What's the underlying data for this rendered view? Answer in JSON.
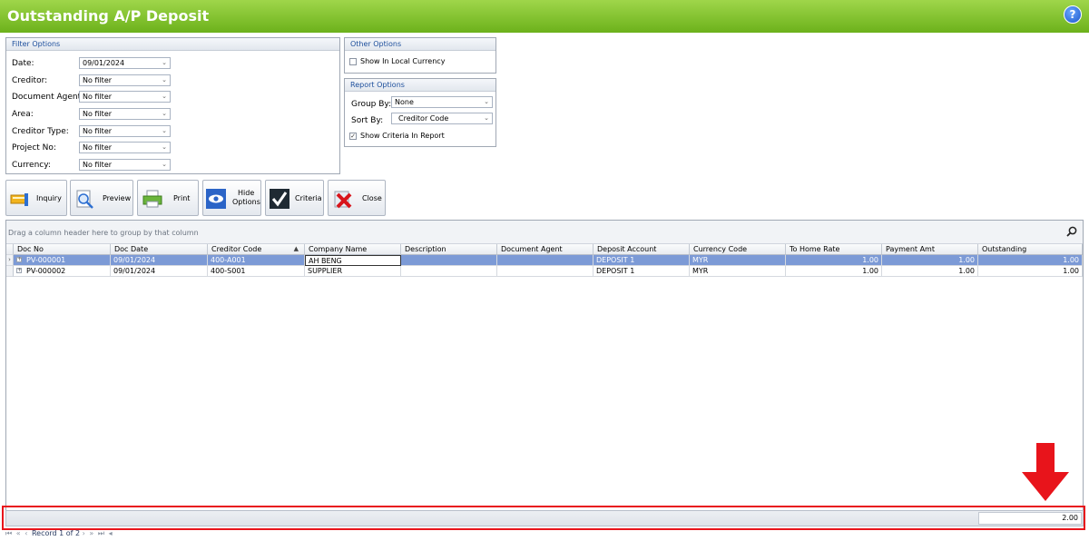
{
  "window": {
    "title": "Outstanding A/P Deposit",
    "help": "?"
  },
  "filter_options": {
    "header": "Filter Options",
    "fields": [
      {
        "label": "Date:",
        "value": "09/01/2024"
      },
      {
        "label": "Creditor:",
        "value": "No filter"
      },
      {
        "label": "Document Agent:",
        "value": "No filter"
      },
      {
        "label": "Area:",
        "value": "No filter"
      },
      {
        "label": "Creditor Type:",
        "value": "No filter"
      },
      {
        "label": "Project No:",
        "value": "No filter"
      },
      {
        "label": "Currency:",
        "value": "No filter"
      }
    ]
  },
  "other_options": {
    "header": "Other Options",
    "show_local_currency": "Show In Local Currency",
    "show_local_currency_checked": false
  },
  "report_options": {
    "header": "Report Options",
    "group_by_label": "Group By:",
    "group_by_value": "None",
    "sort_by_label": "Sort By:",
    "sort_by_value": "Creditor Code",
    "show_criteria": "Show Criteria In Report",
    "show_criteria_checked": true
  },
  "toolbar": {
    "inquiry": "Inquiry",
    "preview": "Preview",
    "print": "Print",
    "hide_options_1": "Hide",
    "hide_options_2": "Options",
    "criteria": "Criteria",
    "close": "Close"
  },
  "grid": {
    "group_hint": "Drag a column header here to group by that column",
    "columns": [
      "Doc No",
      "Doc Date",
      "Creditor Code",
      "Company Name",
      "Description",
      "Document Agent",
      "Deposit Account",
      "Currency Code",
      "To Home Rate",
      "Payment Amt",
      "Outstanding"
    ],
    "rows": [
      [
        "PV-000001",
        "09/01/2024",
        "400-A001",
        "AH BENG",
        "",
        "",
        "DEPOSIT 1",
        "MYR",
        "1.00",
        "1.00",
        "1.00"
      ],
      [
        "PV-000002",
        "09/01/2024",
        "400-S001",
        "SUPPLIER",
        "",
        "",
        "DEPOSIT 1",
        "MYR",
        "1.00",
        "1.00",
        "1.00"
      ]
    ],
    "total_outstanding": "2.00"
  },
  "navigator": {
    "text": "Record 1 of 2"
  },
  "colors": {
    "title_bar": "#6cb11b",
    "selected_row": "#7c9ad6",
    "highlight": "#e8141b"
  }
}
